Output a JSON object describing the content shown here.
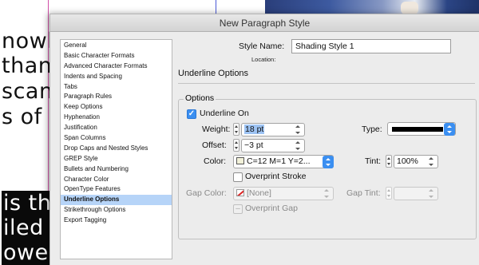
{
  "background": {
    "lines": [
      "nowh",
      "than",
      "scany",
      "s of Re",
      "is the",
      "iled a",
      "ower b"
    ]
  },
  "dialog": {
    "title": "New Paragraph Style",
    "style_name_label": "Style Name:",
    "style_name_value": "Shading Style 1",
    "location_label": "Location:",
    "section_title": "Underline Options",
    "categories": [
      "General",
      "Basic Character Formats",
      "Advanced Character Formats",
      "Indents and Spacing",
      "Tabs",
      "Paragraph Rules",
      "Keep Options",
      "Hyphenation",
      "Justification",
      "Span Columns",
      "Drop Caps and Nested Styles",
      "GREP Style",
      "Bullets and Numbering",
      "Character Color",
      "OpenType Features",
      "Underline Options",
      "Strikethrough Options",
      "Export Tagging"
    ],
    "selected_category": "Underline Options",
    "options": {
      "group_label": "Options",
      "underline_on_label": "Underline On",
      "underline_on": true,
      "weight_label": "Weight:",
      "weight_value": "18 pt",
      "offset_label": "Offset:",
      "offset_value": "−3 pt",
      "type_label": "Type:",
      "color_label": "Color:",
      "color_value": "C=12 M=1 Y=2...",
      "tint_label": "Tint:",
      "tint_value": "100%",
      "overprint_stroke_label": "Overprint Stroke",
      "overprint_stroke": false,
      "gap_color_label": "Gap Color:",
      "gap_color_value": "[None]",
      "gap_tint_label": "Gap Tint:",
      "gap_tint_value": "",
      "overprint_gap_label": "Overprint Gap",
      "overprint_gap": false
    }
  },
  "colors": {
    "selection": "#b6d4f8",
    "accent": "#3b8ff1",
    "swatch": "#f2f1d9",
    "line_type": "#000000"
  }
}
